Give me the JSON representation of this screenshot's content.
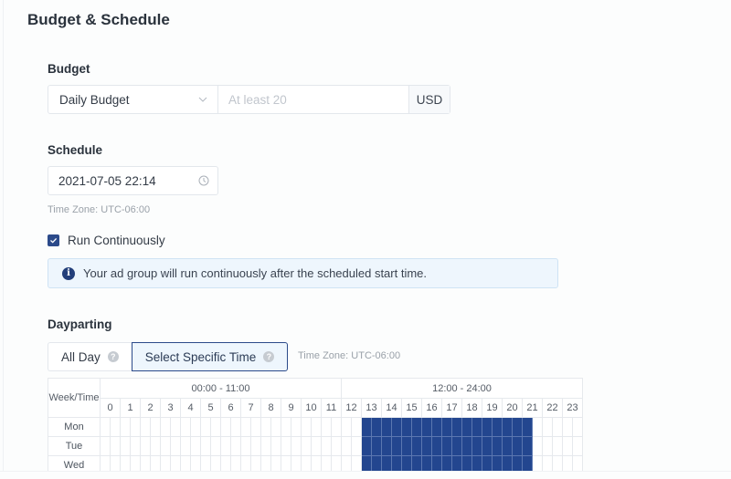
{
  "page_title": "Budget & Schedule",
  "budget": {
    "label": "Budget",
    "type_selected": "Daily Budget",
    "amount_value": "",
    "amount_placeholder": "At least 20",
    "currency": "USD"
  },
  "schedule": {
    "label": "Schedule",
    "start_datetime": "2021-07-05 22:14",
    "time_zone": "Time Zone: UTC-06:00",
    "run_continuously_label": "Run Continuously",
    "run_continuously_checked": true,
    "alert_text": "Your ad group will run continuously after the scheduled start time."
  },
  "dayparting": {
    "label": "Dayparting",
    "options": [
      {
        "label": "All Day",
        "active": false
      },
      {
        "label": "Select Specific Time",
        "active": true
      }
    ],
    "time_zone": "Time Zone: UTC-06:00",
    "grid": {
      "corner_label": "Week/Time",
      "ranges": [
        "00:00 - 11:00",
        "12:00 - 24:00"
      ],
      "hours": [
        "0",
        "1",
        "2",
        "3",
        "4",
        "5",
        "6",
        "7",
        "8",
        "9",
        "10",
        "11",
        "12",
        "13",
        "14",
        "15",
        "16",
        "17",
        "18",
        "19",
        "20",
        "21",
        "22",
        "23"
      ],
      "days": [
        {
          "name": "Mon",
          "selected_half_hour_slots": {
            "from": "13:00",
            "to": "21:30"
          }
        },
        {
          "name": "Tue",
          "selected_half_hour_slots": {
            "from": "13:00",
            "to": "21:30"
          }
        },
        {
          "name": "Wed",
          "selected_half_hour_slots": {
            "from": "13:00",
            "to": "21:30"
          }
        }
      ]
    }
  }
}
